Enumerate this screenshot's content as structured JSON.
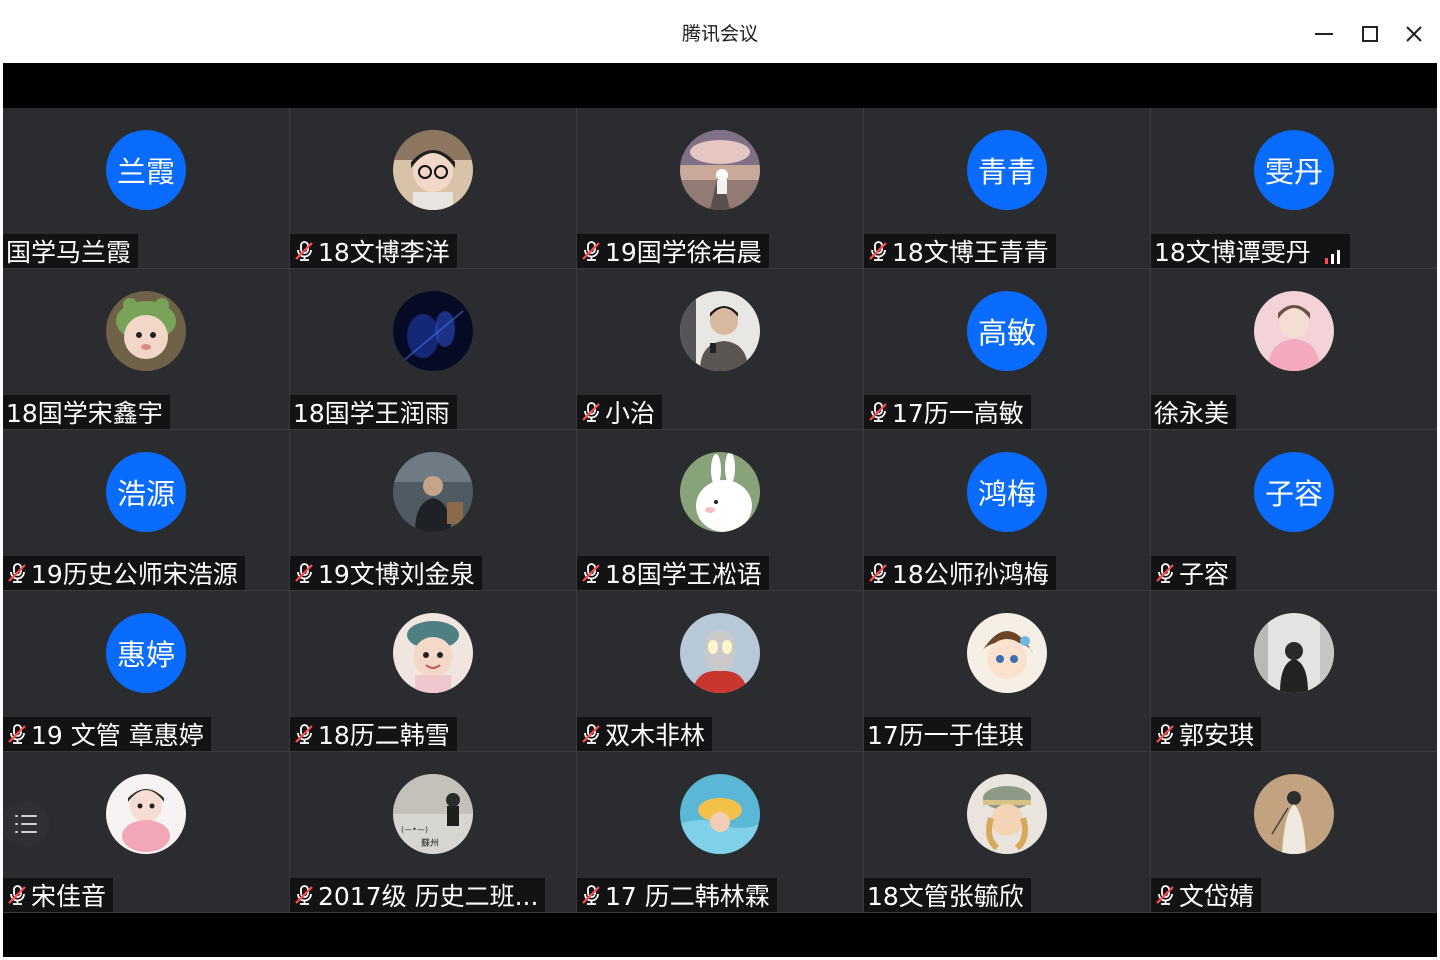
{
  "window": {
    "title": "腾讯会议",
    "minimize_icon": "minimize-icon",
    "maximize_icon": "maximize-icon",
    "close_icon": "close-icon"
  },
  "colors": {
    "avatar_blue": "#0a6cff",
    "tile_bg": "#2b2c30",
    "muted_red": "#ff4d4f",
    "signal_red": "#ff4d4f"
  },
  "participants": [
    {
      "name": "国学马兰霞",
      "avatar_text": "兰霞",
      "avatar": "text",
      "muted": false
    },
    {
      "name": "18文博李洋",
      "avatar": "photo-boy-glasses",
      "muted": true
    },
    {
      "name": "19国学徐岩晨",
      "avatar": "photo-astronaut-road",
      "muted": true
    },
    {
      "name": "18文博王青青",
      "avatar_text": "青青",
      "avatar": "text",
      "muted": true
    },
    {
      "name": "18文博谭雯丹",
      "avatar_text": "雯丹",
      "avatar": "text",
      "muted": false,
      "signal": "signal-weak-icon"
    },
    {
      "name": "18国学宋鑫宇",
      "avatar": "photo-baby-frog-hat",
      "muted": false
    },
    {
      "name": "18国学王润雨",
      "avatar": "photo-dark-blue",
      "muted": false
    },
    {
      "name": "小治",
      "avatar": "photo-man-phone",
      "muted": true
    },
    {
      "name": "17历一高敏",
      "avatar_text": "高敏",
      "avatar": "text",
      "muted": true
    },
    {
      "name": "徐永美",
      "avatar": "photo-pink-idol",
      "muted": false
    },
    {
      "name": "19历史公师宋浩源",
      "avatar_text": "浩源",
      "avatar": "text",
      "muted": true
    },
    {
      "name": "19文博刘金泉",
      "avatar": "photo-man-sitting",
      "muted": true
    },
    {
      "name": "18国学王凇语",
      "avatar": "photo-white-rabbit",
      "muted": true
    },
    {
      "name": "18公师孙鸿梅",
      "avatar_text": "鸿梅",
      "avatar": "text",
      "muted": true
    },
    {
      "name": "子容",
      "avatar_text": "子容",
      "avatar": "text",
      "muted": true
    },
    {
      "name": "19 文管 章惠婷",
      "avatar_text": "惠婷",
      "avatar": "text",
      "muted": true
    },
    {
      "name": "18历二韩雪",
      "avatar": "photo-girl-beret",
      "muted": true
    },
    {
      "name": "双木非林",
      "avatar": "photo-ultraman",
      "muted": true
    },
    {
      "name": "17历一于佳琪",
      "avatar": "photo-anime-boy",
      "muted": false
    },
    {
      "name": "郭安琪",
      "avatar": "photo-girl-silhouette",
      "muted": true
    },
    {
      "name": "宋佳音",
      "avatar": "photo-doll-pink",
      "muted": true
    },
    {
      "name": "2017级 历史二班...",
      "avatar": "photo-suzhou-poster",
      "muted": true
    },
    {
      "name": "17 历二韩林霖",
      "avatar": "photo-kid-swimming",
      "muted": true
    },
    {
      "name": "18文管张毓欣",
      "avatar": "photo-girl-cap",
      "muted": false
    },
    {
      "name": "文岱婧",
      "avatar": "photo-ink-figure",
      "muted": true
    }
  ],
  "side_button_icon": "participant-list-icon"
}
